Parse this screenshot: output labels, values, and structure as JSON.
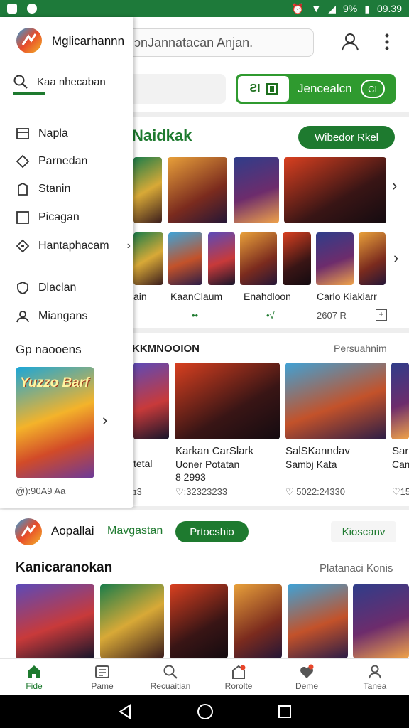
{
  "status_bar": {
    "battery": "9%",
    "time": "09.39"
  },
  "app_bar": {
    "search_placeholder": "ɔnJannatacan Anjan."
  },
  "top_toggle": {
    "segment_label": "ƧI",
    "label": "Jencealcn",
    "pill": "CI"
  },
  "section1": {
    "title": "Naidkak",
    "button": "Wibedor Rkel",
    "captions": [
      "ain",
      "KaanClaum",
      "Enahdloon",
      "Carlo Kiakiarr"
    ],
    "meta": [
      "••",
      "•√",
      "2607 R"
    ]
  },
  "section2": {
    "title": "KKMNOOION",
    "link": "Persuahnim",
    "cards": [
      {
        "title": "",
        "line1": "",
        "line2": "tetal",
        "line3": "ɪ3"
      },
      {
        "title": "Karkan CarSlark",
        "line1": "Uoner Potatan",
        "line2": "8 2993",
        "line3": "♡:32323233"
      },
      {
        "title": "SalSKanndav",
        "line1": "Sambj Kata",
        "line2": "",
        "line3": "♡ 5022:24330"
      },
      {
        "title": "Sar",
        "line1": "Cam",
        "line2": "",
        "line3": "♡15"
      }
    ]
  },
  "promo_row": {
    "name": "Aopallai",
    "nav": "Mavgastan",
    "button": "Prtocshio",
    "right": "Kioscanv"
  },
  "section3": {
    "title": "Kanicaranokan",
    "link": "Platanaci Konis"
  },
  "bottom_nav": [
    {
      "label": "Fide",
      "icon": "home-icon"
    },
    {
      "label": "Pame",
      "icon": "document-icon"
    },
    {
      "label": "Recuaitian",
      "icon": "search-icon"
    },
    {
      "label": "Rorolte",
      "icon": "store-icon"
    },
    {
      "label": "Deme",
      "icon": "badge-icon"
    },
    {
      "label": "Tanea",
      "icon": "user-icon"
    }
  ],
  "drawer": {
    "title": "Mglicarhannn",
    "search_value": "Kaa nhecaban",
    "items": [
      {
        "label": "Napla",
        "icon": "layout-icon"
      },
      {
        "label": "Parnedan",
        "icon": "diamond-icon"
      },
      {
        "label": "Stanin",
        "icon": "bookmark-icon"
      },
      {
        "label": "Picagan",
        "icon": "square-icon"
      },
      {
        "label": "Hantaphacam",
        "icon": "tag-icon"
      },
      {
        "label": "Dlaclan",
        "icon": "shield-icon"
      },
      {
        "label": "Miangans",
        "icon": "group-icon"
      }
    ],
    "section_title": "Gp naooens",
    "card_title": "Yuzzo Barf",
    "footer": "@):90A9 Aa"
  },
  "colors": {
    "brand_green": "#1e7a2f",
    "status_bar": "#1e7a3a"
  }
}
